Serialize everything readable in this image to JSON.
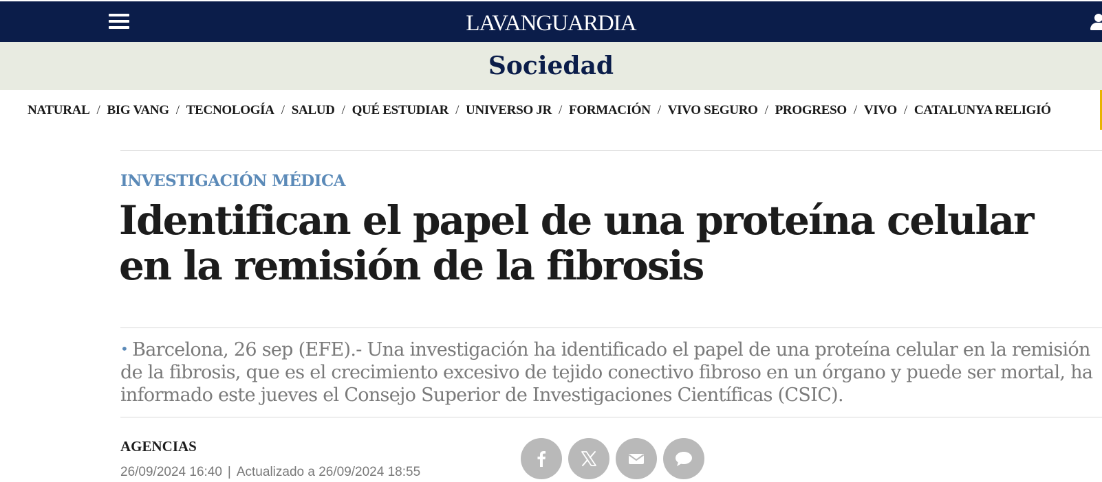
{
  "header": {
    "menu_icon": "hamburger-menu-icon",
    "logo": "LAVANGUARDIA",
    "user_icon": "user-icon",
    "background": "#0b1d4a"
  },
  "section": {
    "title": "Sociedad",
    "background": "#e8ebe1"
  },
  "subnav": {
    "items": [
      "NATURAL",
      "BIG VANG",
      "TECNOLOGÍA",
      "SALUD",
      "QUÉ ESTUDIAR",
      "UNIVERSO JR",
      "FORMACIÓN",
      "VIVO SEGURO",
      "PROGRESO",
      "VIVO",
      "CATALUNYA RELIGIÓ"
    ],
    "separator": "/"
  },
  "article": {
    "kicker": "INVESTIGACIÓN MÉDICA",
    "kicker_color": "#5b8ab8",
    "headline": "Identifican el papel de una proteína celular en la remisión de la fibrosis",
    "lead_bullet": "•",
    "lead": "Barcelona, 26 sep (EFE).- Una investigación ha identificado el papel de una proteína celular en la remisión de la fibrosis, que es el crecimiento excesivo de tejido conectivo fibroso en un órgano y puede ser mortal, ha informado este jueves el Consejo Superior de Investigaciones Científicas (CSIC).",
    "author": "AGENCIAS",
    "published": "26/09/2024 16:40",
    "date_divider": "|",
    "updated": "Actualizado a 26/09/2024 18:55"
  },
  "share_buttons": [
    {
      "icon": "facebook-icon"
    },
    {
      "icon": "x-twitter-icon"
    },
    {
      "icon": "email-icon"
    },
    {
      "icon": "comment-icon"
    }
  ]
}
